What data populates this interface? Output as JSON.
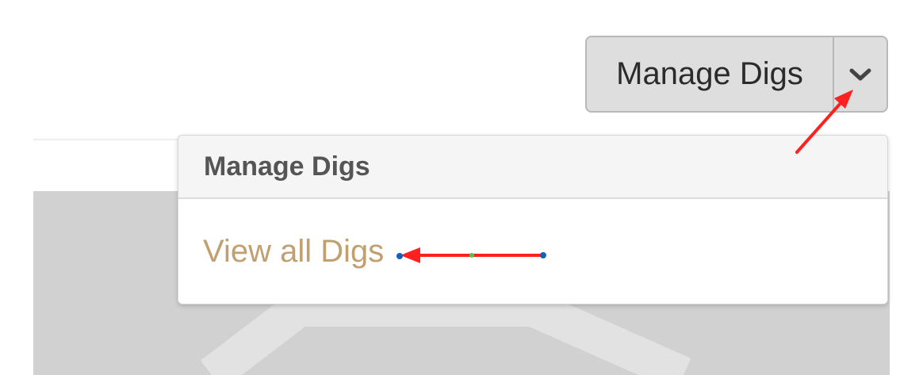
{
  "split_button": {
    "label": "Manage Digs",
    "toggle_icon": "chevron-down-icon"
  },
  "dropdown": {
    "header": "Manage Digs",
    "items": [
      {
        "label": "View all Digs"
      }
    ]
  },
  "annotations": {
    "arrow_color": "#ff2020"
  },
  "colors": {
    "link": "#c0a070",
    "button_bg": "#dedede",
    "background_panel": "#d1d1d1"
  }
}
